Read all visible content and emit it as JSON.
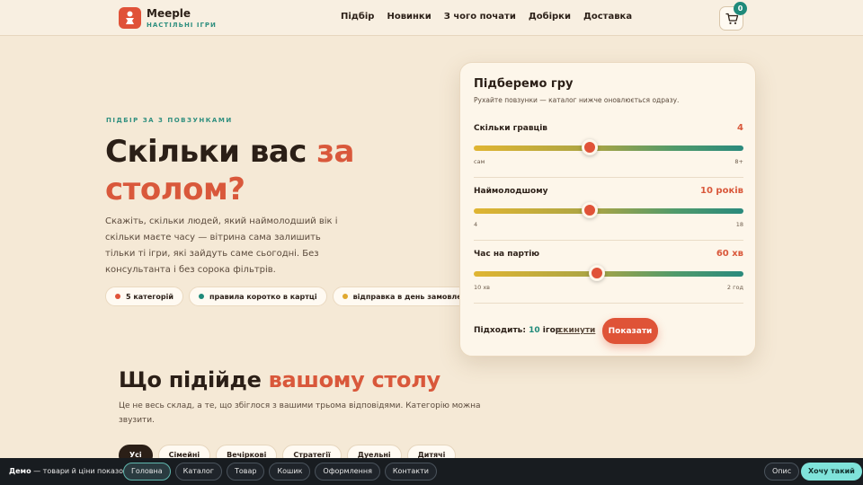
{
  "header": {
    "brand": "Meeple",
    "tagline": "НАСТІЛЬНІ ІГРИ",
    "nav": [
      "Підбір",
      "Новинки",
      "З чого почати",
      "Добірки",
      "Доставка"
    ],
    "cart_count": "0"
  },
  "hero": {
    "eyebrow": "ПІДБІР ЗА 3 ПОВЗУНКАМИ",
    "title_plain": "Скільки вас ",
    "title_accent_1": "за",
    "title_accent_2": "столом?",
    "text": "Скажіть, скільки людей, який наймолодший вік і скільки маєте часу — вітрина сама залишить тільки ті ігри, які зайдуть саме сьогодні. Без консультанта і без сорока фільтрів.",
    "chips": [
      {
        "label": "5 категорій",
        "color": "#e05238"
      },
      {
        "label": "правила коротко в картці",
        "color": "#1f8a7a"
      },
      {
        "label": "відправка в день замовлення",
        "color": "#e0a82e"
      }
    ]
  },
  "picker": {
    "title": "Підберемо гру",
    "subtitle": "Рухайте повзунки — каталог нижче оновлюється одразу.",
    "sliders": [
      {
        "label": "Скільки гравців",
        "value": "4",
        "min_label": "сам",
        "max_label": "8+",
        "level": 0.43
      },
      {
        "label": "Наймолодшому",
        "value": "10 років",
        "min_label": "4",
        "max_label": "18",
        "level": 0.43
      },
      {
        "label": "Час на партію",
        "value": "60 хв",
        "min_label": "10 хв",
        "max_label": "2 год",
        "level": 0.457
      }
    ],
    "match_label": "Підходить:",
    "match_count": "10",
    "match_unit": "ігор",
    "reset_label": "скинути",
    "show_label": "Показати"
  },
  "section": {
    "title_plain": "Що підійде ",
    "title_accent": "вашому столу",
    "text": "Це не весь склад, а те, що збіглося з вашими трьома відповідями. Категорію можна звузити.",
    "categories": [
      "Усі",
      "Сімейні",
      "Вечіркові",
      "Стратегії",
      "Дуельні",
      "Дитячі"
    ]
  },
  "demo": {
    "label_bold": "Демо",
    "label_rest": " — товари й ціни показові:",
    "links": [
      "Головна",
      "Каталог",
      "Товар",
      "Кошик",
      "Оформлення",
      "Контакти"
    ],
    "desc_label": "Опис",
    "want_label": "Хочу такий"
  },
  "colors": {
    "accent": "#d9583b",
    "teal": "#1f8a7a",
    "background": "#f5e9d6"
  }
}
